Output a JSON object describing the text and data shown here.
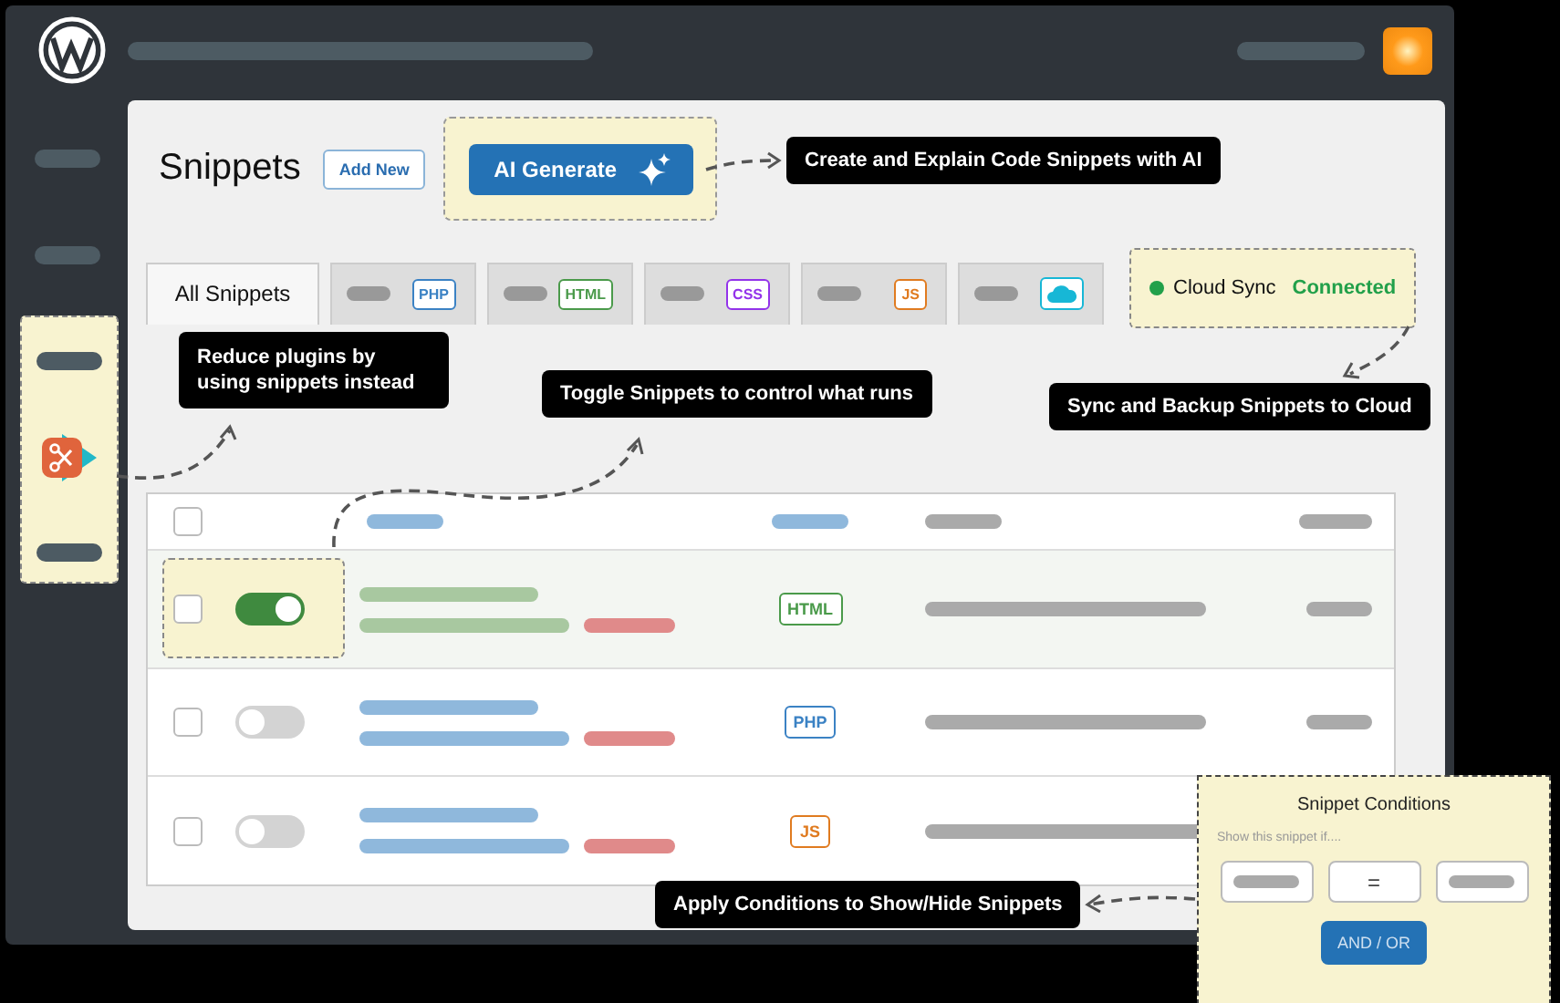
{
  "page": {
    "title": "Snippets",
    "add_new": "Add New",
    "ai_button": "AI Generate"
  },
  "tabs": [
    {
      "kind": "all",
      "label": "All Snippets",
      "selected": true
    },
    {
      "kind": "badge",
      "badge": "PHP",
      "color": "#3b82c4",
      "selected": false
    },
    {
      "kind": "badge",
      "badge": "HTML",
      "color": "#4a9a4a",
      "selected": false
    },
    {
      "kind": "badge",
      "badge": "CSS",
      "color": "#9333ea",
      "selected": false
    },
    {
      "kind": "badge",
      "badge": "JS",
      "color": "#e07b20",
      "selected": false
    },
    {
      "kind": "cloud",
      "color": "#17b7d6",
      "selected": false
    }
  ],
  "cloud_sync": {
    "label": "Cloud Sync",
    "status": "Connected",
    "connected": true
  },
  "table": {
    "select_all_checked": false,
    "rows": [
      {
        "checked": false,
        "on": true,
        "highlighted": true,
        "type": "HTML",
        "color": "#4a9a4a"
      },
      {
        "checked": false,
        "on": false,
        "highlighted": false,
        "type": "PHP",
        "color": "#3b82c4"
      },
      {
        "checked": false,
        "on": false,
        "highlighted": false,
        "type": "JS",
        "color": "#e07b20"
      }
    ]
  },
  "callouts": [
    "Create and Explain Code Snippets with AI",
    "Reduce plugins by using snippets instead",
    "Toggle Snippets to control what runs",
    "Sync and Backup Snippets to Cloud",
    "Apply Conditions to Show/Hide Snippets"
  ],
  "conditions": {
    "title": "Snippet Conditions",
    "hint": "Show this snippet if....",
    "operator": "=",
    "button": "AND / OR"
  }
}
